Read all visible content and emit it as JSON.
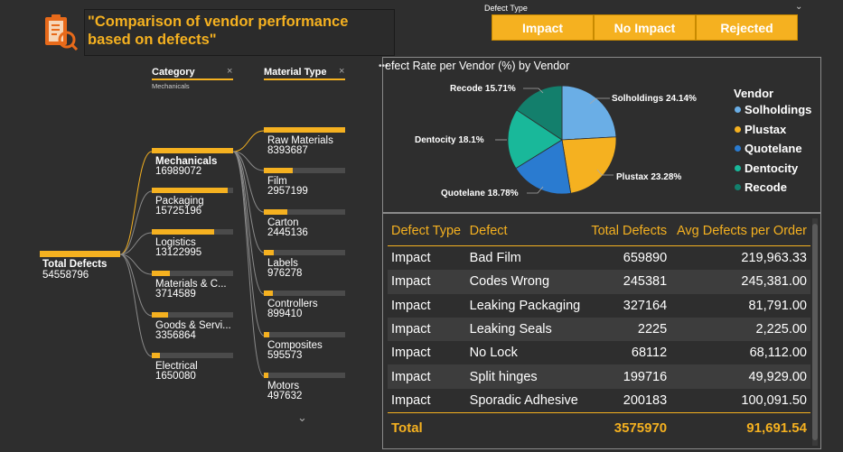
{
  "header": {
    "title": "\"Comparison of vendor performance based on defects\"",
    "logo_icon": "clipboard-checklist-icon"
  },
  "defect_type_slicer": {
    "label": "Defect Type",
    "options": [
      "Impact",
      "No Impact",
      "Rejected"
    ]
  },
  "category_filter": {
    "header": "Category",
    "selected": "Mechanicals"
  },
  "material_filter": {
    "header": "Material Type"
  },
  "tree": {
    "root": {
      "name": "Total Defects",
      "value": "54558796"
    },
    "categories": [
      {
        "name": "Mechanicals",
        "value": "16989072",
        "fill": 1.0
      },
      {
        "name": "Packaging",
        "value": "15725196",
        "fill": 0.93
      },
      {
        "name": "Logistics",
        "value": "13122995",
        "fill": 0.77
      },
      {
        "name": "Materials & C...",
        "value": "3714589",
        "fill": 0.22
      },
      {
        "name": "Goods & Servi...",
        "value": "3356864",
        "fill": 0.2
      },
      {
        "name": "Electrical",
        "value": "1650080",
        "fill": 0.1
      }
    ],
    "materials": [
      {
        "name": "Raw Materials",
        "value": "8393687",
        "fill": 1.0
      },
      {
        "name": "Film",
        "value": "2957199",
        "fill": 0.35
      },
      {
        "name": "Carton",
        "value": "2445136",
        "fill": 0.29
      },
      {
        "name": "Labels",
        "value": "976278",
        "fill": 0.12
      },
      {
        "name": "Controllers",
        "value": "899410",
        "fill": 0.11
      },
      {
        "name": "Composites",
        "value": "595573",
        "fill": 0.07
      },
      {
        "name": "Motors",
        "value": "497632",
        "fill": 0.06
      }
    ]
  },
  "pie": {
    "title": "efect Rate per Vendor (%) by Vendor",
    "legend_title": "Vendor",
    "more_icon": "ellipsis-icon"
  },
  "chart_data": {
    "type": "pie",
    "title": "efect Rate per Vendor (%) by Vendor",
    "legend_title": "Vendor",
    "legend_placement": "right",
    "slices": [
      {
        "name": "Solholdings",
        "value": 24.14,
        "label": "Solholdings 24.14%",
        "color": "#6aaee6"
      },
      {
        "name": "Plustax",
        "value": 23.28,
        "label": "Plustax 23.28%",
        "color": "#f5b120"
      },
      {
        "name": "Quotelane",
        "value": 18.78,
        "label": "Quotelane 18.78%",
        "color": "#2a7bd0"
      },
      {
        "name": "Dentocity",
        "value": 18.1,
        "label": "Dentocity 18.1%",
        "color": "#19b89a"
      },
      {
        "name": "Recode",
        "value": 15.71,
        "label": "Recode 15.71%",
        "color": "#137f6c"
      }
    ]
  },
  "table": {
    "headers": [
      "Defect Type",
      "Defect",
      "Total Defects",
      "Avg Defects per Order"
    ],
    "rows": [
      [
        "Impact",
        "Bad Film",
        "659890",
        "219,963.33"
      ],
      [
        "Impact",
        "Codes Wrong",
        "245381",
        "245,381.00"
      ],
      [
        "Impact",
        "Leaking Packaging",
        "327164",
        "81,791.00"
      ],
      [
        "Impact",
        "Leaking Seals",
        "2225",
        "2,225.00"
      ],
      [
        "Impact",
        "No Lock",
        "68112",
        "68,112.00"
      ],
      [
        "Impact",
        "Split hinges",
        "199716",
        "49,929.00"
      ],
      [
        "Impact",
        "Sporadic Adhesive",
        "200183",
        "100,091.50"
      ]
    ],
    "total": {
      "label": "Total",
      "total_defects": "3575970",
      "avg": "91,691.54"
    }
  },
  "colors": {
    "accent": "#f5b120",
    "background": "#2e2e2e"
  }
}
